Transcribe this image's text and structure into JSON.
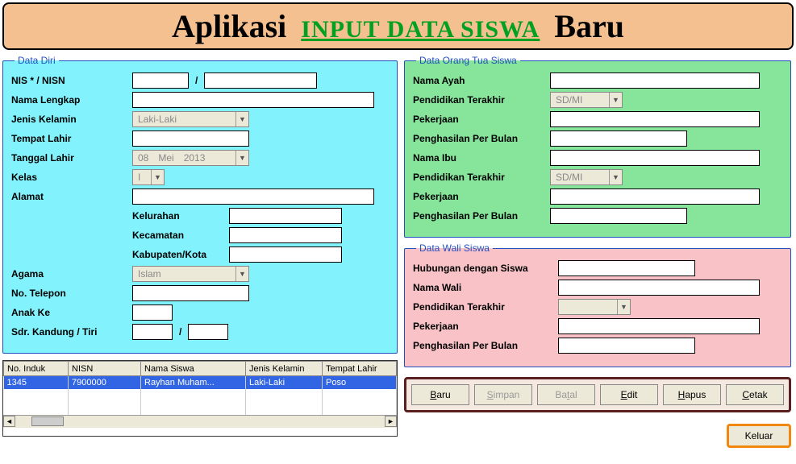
{
  "header": {
    "left": "Aplikasi",
    "mid": "INPUT DATA SISWA",
    "right": "Baru"
  },
  "dataDiri": {
    "legend": "Data Diri",
    "nis_lbl": "NIS *  /  NISN",
    "nama_lbl": "Nama Lengkap",
    "jk_lbl": "Jenis Kelamin",
    "jk_val": "Laki-Laki",
    "tempat_lbl": "Tempat Lahir",
    "tgl_lbl": "Tanggal Lahir",
    "tgl_d": "08",
    "tgl_m": "Mei",
    "tgl_y": "2013",
    "kelas_lbl": "Kelas",
    "kelas_val": "I",
    "alamat_lbl": "Alamat",
    "kel_lbl": "Kelurahan",
    "kec_lbl": "Kecamatan",
    "kab_lbl": "Kabupaten/Kota",
    "agama_lbl": "Agama",
    "agama_val": "Islam",
    "telp_lbl": "No. Telepon",
    "anak_lbl": "Anak Ke",
    "sdr_lbl": "Sdr. Kandung / Tiri"
  },
  "ortu": {
    "legend": "Data Orang Tua Siswa",
    "ayah_lbl": "Nama Ayah",
    "pend1_lbl": "Pendidikan Terakhir",
    "pend1_val": "SD/MI",
    "kerja1_lbl": "Pekerjaan",
    "hasil1_lbl": "Penghasilan Per Bulan",
    "ibu_lbl": "Nama Ibu",
    "pend2_lbl": "Pendidikan Terakhir",
    "pend2_val": "SD/MI",
    "kerja2_lbl": "Pekerjaan",
    "hasil2_lbl": "Penghasilan Per Bulan"
  },
  "wali": {
    "legend": "Data Wali Siswa",
    "hub_lbl": "Hubungan dengan Siswa",
    "nama_lbl": "Nama Wali",
    "pend_lbl": "Pendidikan Terakhir",
    "kerja_lbl": "Pekerjaan",
    "hasil_lbl": "Penghasilan Per Bulan"
  },
  "grid": {
    "cols": [
      "No. Induk",
      "NISN",
      "Nama Siswa",
      "Jenis Kelamin",
      "Tempat Lahir"
    ],
    "rows": [
      {
        "c0": "1345",
        "c1": "7900000",
        "c2": "Rayhan Muham...",
        "c3": "Laki-Laki",
        "c4": "Poso"
      }
    ]
  },
  "buttons": {
    "baru": "Baru",
    "simpan": "Simpan",
    "batal": "Batal",
    "edit": "Edit",
    "hapus": "Hapus",
    "cetak": "Cetak",
    "keluar": "Keluar"
  }
}
